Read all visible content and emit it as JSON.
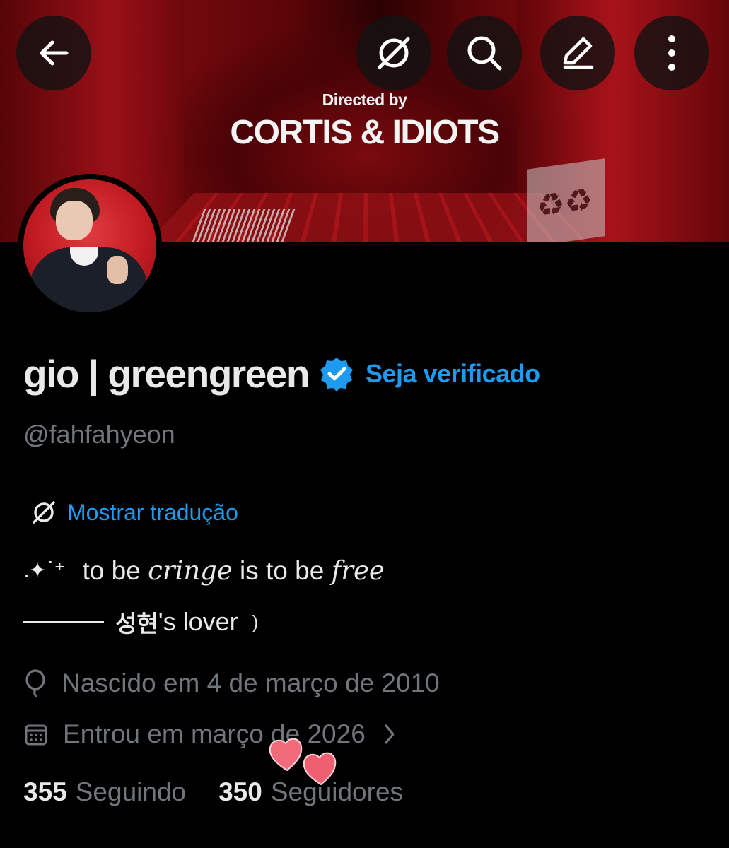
{
  "header": {
    "back_icon": "arrow-left-icon",
    "translate_icon": "translate-globe-icon",
    "search_icon": "search-icon",
    "edit_icon": "edit-pencil-icon",
    "more_icon": "more-vertical-icon"
  },
  "banner": {
    "line1": "Directed by",
    "line2": "CORTIS & IDIOTS"
  },
  "profile": {
    "display_name": "gio | greengreen",
    "verified_badge_color": "#1d9bf0",
    "get_verified_label": "Seja verificado",
    "handle": "@fahfahyeon",
    "translate_label": "Mostrar tradução",
    "bio": {
      "line1_sparkle": ".✦˙⁺",
      "line1_a": "to be",
      "line1_b": "cringe",
      "line1_c": "is to be",
      "line1_d": "free",
      "line2_korean": "성현",
      "line2_rest": "'s  lover",
      "line2_paren": ")"
    },
    "birth": "Nascido em 4 de março de 2010",
    "joined": "Entrou em março de 2026",
    "following_count": "355",
    "following_label": "Seguindo",
    "followers_count": "350",
    "followers_label": "Seguidores"
  },
  "colors": {
    "background": "#000000",
    "accent": "#1d9bf0",
    "muted_text": "#71767b",
    "primary_text": "#e7e9ea",
    "sticker_hearts": "#f26b7a"
  }
}
